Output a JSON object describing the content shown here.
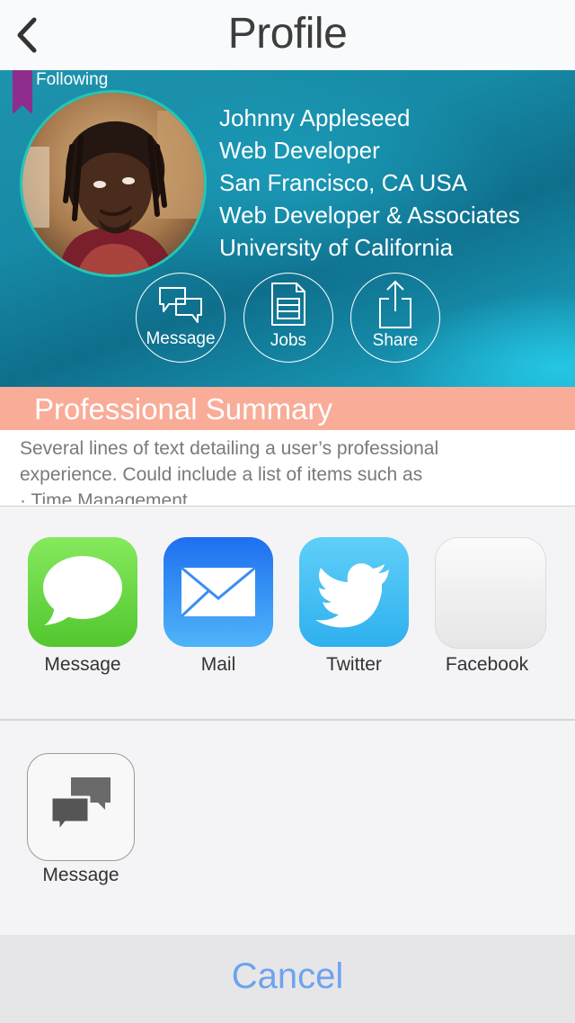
{
  "nav": {
    "title": "Profile"
  },
  "profile": {
    "following_label": "Following",
    "name": "Johnny Appleseed",
    "title": "Web Developer",
    "location": "San Francisco, CA  USA",
    "company": "Web Developer & Associates",
    "school": "University of California",
    "actions": [
      {
        "label": "Message",
        "icon": "chat-bubbles-icon"
      },
      {
        "label": "Jobs",
        "icon": "document-icon"
      },
      {
        "label": "Share",
        "icon": "share-icon"
      }
    ]
  },
  "summary": {
    "heading": "Professional Summary",
    "line1": "Several lines of text detailing a user’s professional",
    "line2": "experience.  Could include a list of items such as",
    "line3": "·  Time Management"
  },
  "share_sheet": {
    "apps": [
      {
        "label": "Message",
        "icon": "messages-app-icon"
      },
      {
        "label": "Mail",
        "icon": "mail-app-icon"
      },
      {
        "label": "Twitter",
        "icon": "twitter-app-icon"
      },
      {
        "label": "Facebook",
        "icon": "facebook-app-icon"
      }
    ],
    "actions": [
      {
        "label": "Message",
        "icon": "chat-bubbles-icon"
      }
    ],
    "cancel_label": "Cancel"
  },
  "colors": {
    "summary_header": "#f9ac98",
    "ribbon": "#8e2d8c",
    "avatar_ring": "#24c6b4",
    "cancel_text": "#6ea3ee"
  }
}
